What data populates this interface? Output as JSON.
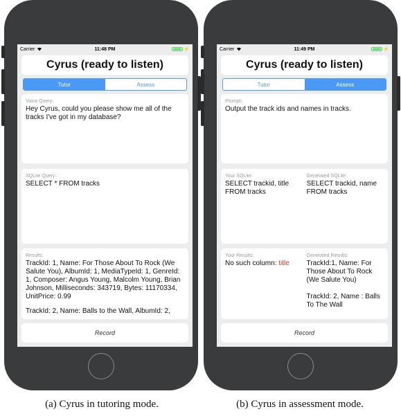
{
  "phones": {
    "a": {
      "status": {
        "carrier": "Carrier",
        "time": "11:48 PM"
      },
      "title": "Cyrus (ready to listen)",
      "tabs": [
        "Tutor",
        "Assess"
      ],
      "active_tab": "Tutor",
      "voice_query": {
        "label": "Voice Query:",
        "text": "Hey Cyrus, could you please show me all of the tracks I've got in my database?"
      },
      "sqlite_query": {
        "label": "SQLite Query:",
        "text": "SELECT * FROM tracks"
      },
      "results": {
        "label": "Results:",
        "text1": "TrackId: 1, Name: For Those About To Rock (We Salute You), AlbumId: 1, MediaTypeId: 1, GenreId: 1, Composer: Angus Young, Malcolm Young, Brian Johnson, Milliseconds: 343719, Bytes: 11170334, UnitPrice: 0.99",
        "text2": "TrackId: 2, Name: Balls to the Wall, AlbumId: 2,"
      },
      "record_label": "Record",
      "caption": "(a)  Cyrus in tutoring mode."
    },
    "b": {
      "status": {
        "carrier": "Carrier",
        "time": "11:49 PM"
      },
      "title": "Cyrus (ready to listen)",
      "tabs": [
        "Tutor",
        "Assess"
      ],
      "active_tab": "Assess",
      "prompt": {
        "label": "Prompt:",
        "text": "Output the track ids and names in tracks."
      },
      "your_sqlite": {
        "label": "Your SQLite:",
        "text": "SELECT trackid, title FROM tracks"
      },
      "generated_sqlite": {
        "label": "Generated SQLite:",
        "text": "SELECT trackid, name FROM tracks"
      },
      "your_results": {
        "label": "Your Results:",
        "text": "No such column: ",
        "error_word": "title"
      },
      "generated_results": {
        "label": "Generated Results:",
        "text1": "TrackId:1, Name: For Those About To Rock (We Salute You)",
        "text2": "TrackId: 2, Name : Balls To The Wall"
      },
      "record_label": "Record",
      "caption": "(b)  Cyrus in assessment mode."
    }
  },
  "colors": {
    "accent": "#4a9af5",
    "error": "#e0322a",
    "battery": "#4cd964"
  }
}
